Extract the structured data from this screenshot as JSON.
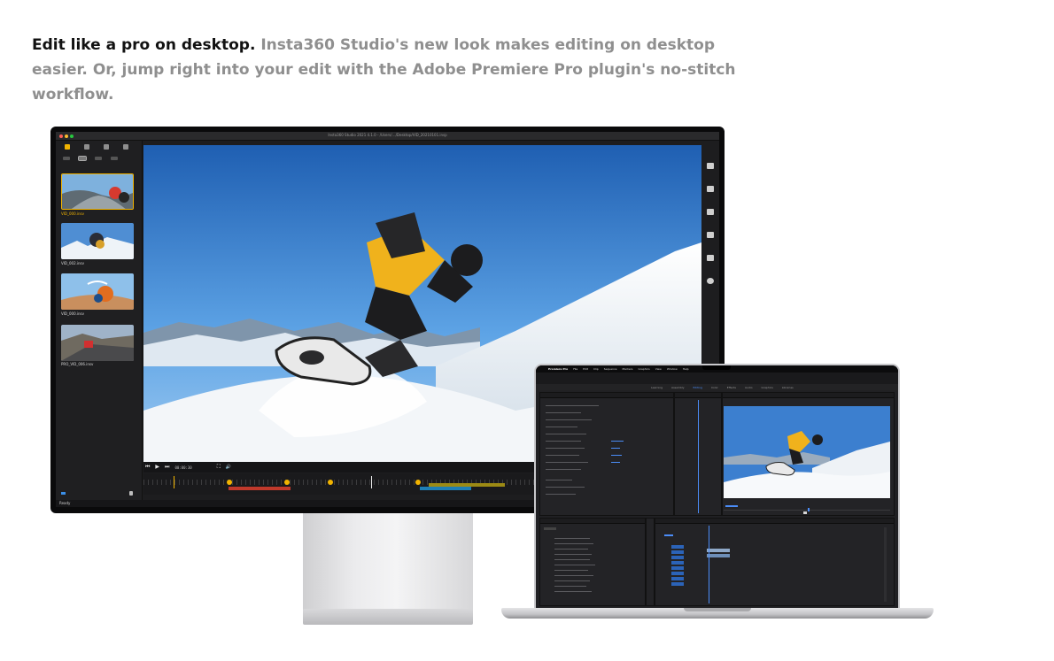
{
  "headline": {
    "lead": "Edit like a pro on desktop.",
    "body": " Insta360 Studio's new look makes editing on desktop easier. Or, jump right into your edit with the Adobe Premiere Pro plugin's no-stitch workflow."
  },
  "studio": {
    "window_title": "Insta360 Studio 2021 4.1.0 - /Users/…/Desktop/VID_20210101.insp",
    "clips": [
      {
        "label": "VID_000.insv",
        "selected": true
      },
      {
        "label": "VID_002.insv",
        "selected": false
      },
      {
        "label": "VID_000.insv",
        "selected": false
      },
      {
        "label": "PRO_VID_006.insv",
        "selected": false
      }
    ],
    "playback": {
      "prev": "⏮",
      "play": "▶",
      "next": "⏭",
      "time": "00:00:30",
      "fullscreen": "⛶",
      "volume": "🔊"
    },
    "status": "Ready",
    "colors": {
      "accent": "#f2b400",
      "segment_red": "#c0392b",
      "segment_olive": "#9c8a14",
      "segment_blue": "#1e7fb5"
    }
  },
  "premiere": {
    "menu": [
      "Premiere Pro",
      "File",
      "Edit",
      "Clip",
      "Sequence",
      "Markers",
      "Graphics",
      "View",
      "Window",
      "Help"
    ],
    "workspaces": [
      "Learning",
      "Assembly",
      "Editing",
      "Color",
      "Effects",
      "Audio",
      "Graphics",
      "Libraries"
    ],
    "active_workspace": "Editing",
    "accent": "#4b8df8"
  }
}
